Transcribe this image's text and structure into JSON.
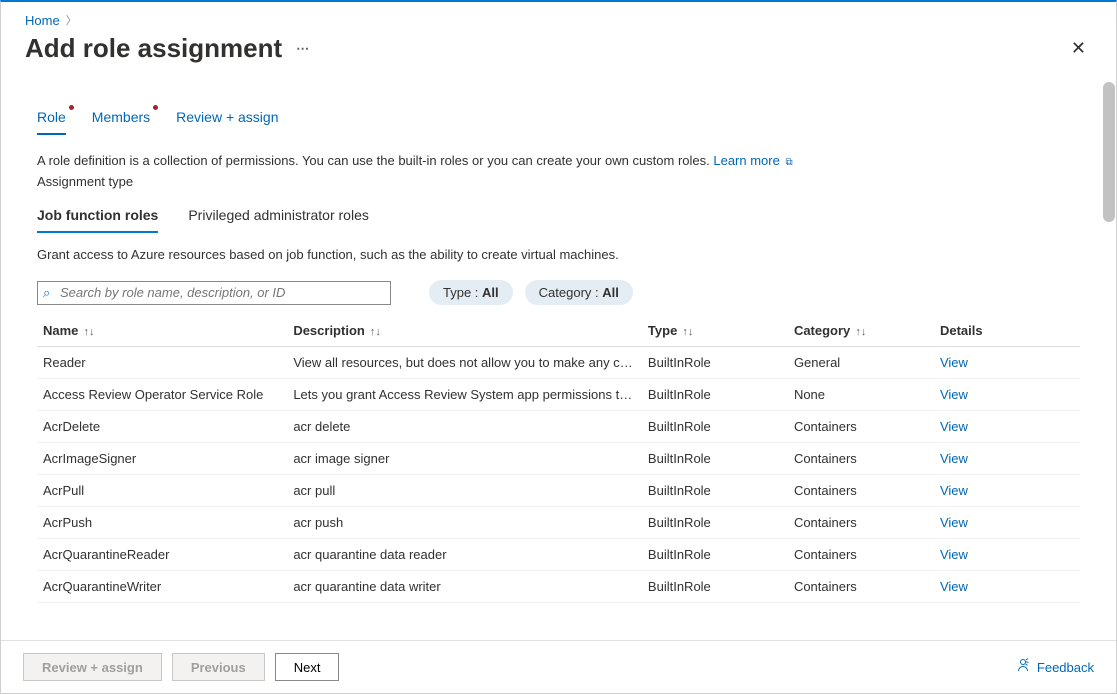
{
  "breadcrumb": {
    "home": "Home"
  },
  "page": {
    "title": "Add role assignment"
  },
  "tabs": {
    "role": "Role",
    "members": "Members",
    "review": "Review + assign"
  },
  "intro": {
    "text": "A role definition is a collection of permissions. You can use the built-in roles or you can create your own custom roles. ",
    "learn_more": "Learn more"
  },
  "assignment_type_label": "Assignment type",
  "subtabs": {
    "job_function": "Job function roles",
    "privileged": "Privileged administrator roles"
  },
  "subdesc": "Grant access to Azure resources based on job function, such as the ability to create virtual machines.",
  "search": {
    "placeholder": "Search by role name, description, or ID"
  },
  "filters": {
    "type_label": "Type : ",
    "type_value": "All",
    "category_label": "Category : ",
    "category_value": "All"
  },
  "columns": {
    "name": "Name",
    "description": "Description",
    "type": "Type",
    "category": "Category",
    "details": "Details"
  },
  "view_label": "View",
  "rows": [
    {
      "name": "Reader",
      "description": "View all resources, but does not allow you to make any ch…",
      "type": "BuiltInRole",
      "category": "General"
    },
    {
      "name": "Access Review Operator Service Role",
      "description": "Lets you grant Access Review System app permissions to …",
      "type": "BuiltInRole",
      "category": "None"
    },
    {
      "name": "AcrDelete",
      "description": "acr delete",
      "type": "BuiltInRole",
      "category": "Containers"
    },
    {
      "name": "AcrImageSigner",
      "description": "acr image signer",
      "type": "BuiltInRole",
      "category": "Containers"
    },
    {
      "name": "AcrPull",
      "description": "acr pull",
      "type": "BuiltInRole",
      "category": "Containers"
    },
    {
      "name": "AcrPush",
      "description": "acr push",
      "type": "BuiltInRole",
      "category": "Containers"
    },
    {
      "name": "AcrQuarantineReader",
      "description": "acr quarantine data reader",
      "type": "BuiltInRole",
      "category": "Containers"
    },
    {
      "name": "AcrQuarantineWriter",
      "description": "acr quarantine data writer",
      "type": "BuiltInRole",
      "category": "Containers"
    }
  ],
  "footer": {
    "review": "Review + assign",
    "previous": "Previous",
    "next": "Next",
    "feedback": "Feedback"
  }
}
